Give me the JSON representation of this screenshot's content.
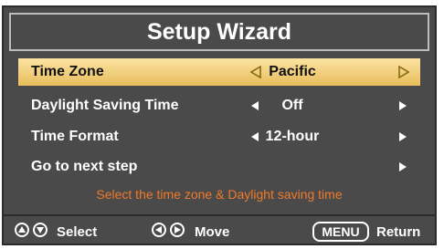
{
  "title": "Setup Wizard",
  "rows": [
    {
      "label": "Time Zone",
      "value": "Pacific"
    },
    {
      "label": "Daylight Saving Time",
      "value": "Off"
    },
    {
      "label": "Time Format",
      "value": "12-hour"
    },
    {
      "label": "Go to next step",
      "value": ""
    }
  ],
  "hint": "Select the time zone & Daylight saving time",
  "footer": {
    "select_label": "Select",
    "move_label": "Move",
    "menu_key": "MENU",
    "return_label": "Return"
  },
  "colors": {
    "panel_bg": "#4a4a4a",
    "selected_bg": "#f2cf7e",
    "hint_text": "#f07a2a",
    "text": "#ffffff"
  },
  "icons": [
    "left-arrow-outline-icon",
    "right-arrow-outline-icon",
    "left-arrow-icon",
    "right-arrow-icon",
    "up-circle-icon",
    "down-circle-icon",
    "left-circle-icon",
    "right-circle-icon"
  ]
}
